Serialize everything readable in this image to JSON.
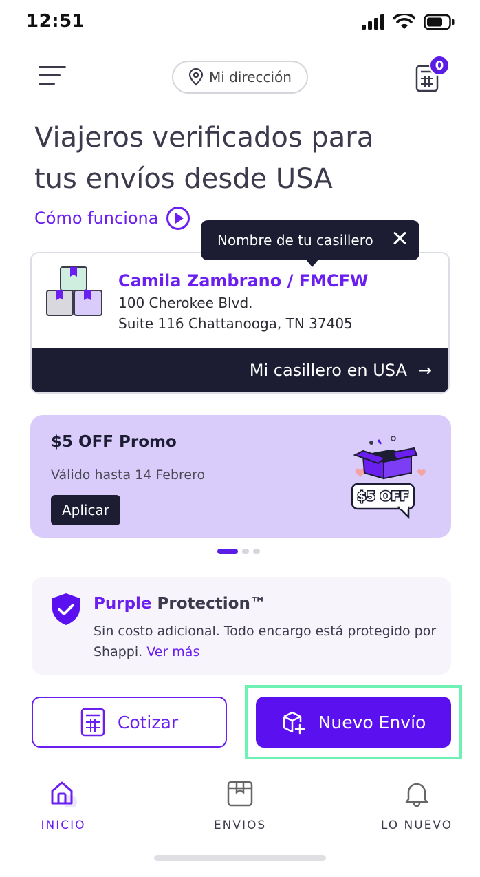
{
  "status_bar": {
    "time": "12:51"
  },
  "header": {
    "address_label": "Mi dirección",
    "calculator_badge": "0"
  },
  "headline": {
    "line1": "Viajeros verificados para",
    "line2": "tus envíos desde USA"
  },
  "how_it_works": {
    "label": "Cómo funciona"
  },
  "tooltip": {
    "text": "Nombre de tu casillero"
  },
  "locker": {
    "name": "Camila Zambrano / FMCFW",
    "address_line1": "100 Cherokee Blvd.",
    "address_line2": "Suite 116 Chattanooga, TN 37405",
    "footer_label": "Mi casillero en USA",
    "footer_arrow": "→"
  },
  "promo": {
    "title": "$5 OFF Promo",
    "validity": "Válido hasta 14 Febrero",
    "button_label": "Aplicar",
    "art_text": "$5 OFF",
    "carousel_active_index": 0,
    "carousel_count": 3
  },
  "protection": {
    "title_accent": "Purple",
    "title_rest": " Protection™",
    "text": "Sin costo adicional. Todo encargo está protegido por Shappi. ",
    "more_link": "Ver más"
  },
  "actions": {
    "quote_label": "Cotizar",
    "new_shipment_label": "Nuevo Envío"
  },
  "bottom_nav": {
    "items": [
      {
        "label": "INICIO",
        "icon": "home-icon",
        "active": true
      },
      {
        "label": "ENVIOS",
        "icon": "box-icon",
        "active": false
      },
      {
        "label": "LO NUEVO",
        "icon": "bell-icon",
        "active": false
      }
    ]
  },
  "colors": {
    "brand_purple": "#6a1ff0",
    "dark_navy": "#1c1c33",
    "promo_bg": "#d9ccfb",
    "highlight_green": "#6ef2b4"
  }
}
